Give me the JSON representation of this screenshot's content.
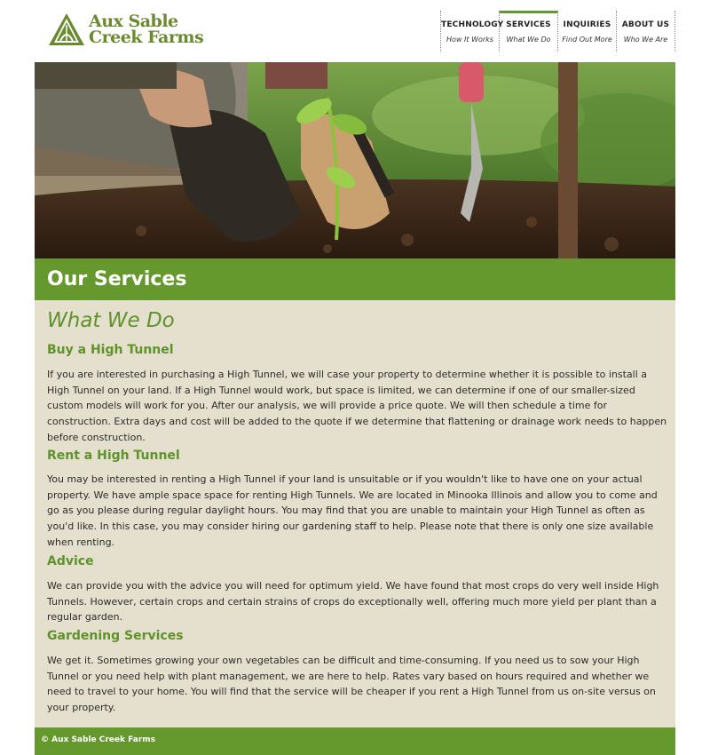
{
  "brand": {
    "line1": "Aux Sable",
    "line2": "Creek Farms"
  },
  "nav": [
    {
      "label": "TECHNOLOGY",
      "sub": "How It Works"
    },
    {
      "label": "SERVICES",
      "sub": "What We Do"
    },
    {
      "label": "INQUIRIES",
      "sub": "Find Out More"
    },
    {
      "label": "ABOUT US",
      "sub": "Who We Are"
    }
  ],
  "page": {
    "title": "Our Services",
    "subtitle": "What We Do"
  },
  "sections": [
    {
      "heading": "Buy a High Tunnel",
      "body": "If you are interested in purchasing a High Tunnel, we will case your property to determine whether it is possible to install a High Tunnel on your land. If a High Tunnel would work, but space is limited, we can determine if one of our smaller-sized custom models will work for you. After our analysis, we will provide a price quote. We will then schedule a time for construction. Extra days and cost will be added to the quote if we determine that flattening or drainage work needs to happen before construction."
    },
    {
      "heading": "Rent a High Tunnel",
      "body": "You may be interested in renting a High Tunnel if your land is unsuitable or if you wouldn't like to have one on your actual property. We have ample space space for renting High Tunnels. We are located in Minooka Illinois and allow you to come and go as you please during regular daylight hours. You may find that you are unable to maintain your High Tunnel as often as you'd like. In this case, you may consider hiring our gardening staff to help. Please note that there is only one size available when renting."
    },
    {
      "heading": "Advice",
      "body": "We can provide you with the advice you will need for optimum yield. We have found that most crops do very well inside High Tunnels. However, certain crops and certain strains of crops do exceptionally well, offering much more yield per plant than a regular garden."
    },
    {
      "heading": "Gardening Services",
      "body": "We get it. Sometimes growing your own vegetables can be difficult and time-consuming. If you need us to sow your High Tunnel or you need help with plant management, we are here to help. Rates vary based on hours required and whether we need to travel to your home. You will find that the service will be cheaper if you rent a High Tunnel from us on-site versus on your property."
    }
  ],
  "footer": {
    "copyright": "© Aux Sable Creek Farms"
  },
  "colors": {
    "accent": "#65982d",
    "content_bg": "#e5e0cd"
  },
  "icons": {
    "logo": "tunnel-triangle-icon"
  }
}
